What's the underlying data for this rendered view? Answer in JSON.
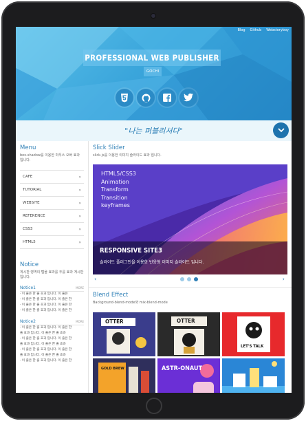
{
  "header": {
    "top_links": [
      "Blog",
      "Github",
      "Webstoryboy"
    ],
    "title": "PROFESSIONAL WEB PUBLISHER",
    "subtitle": "GOCHI",
    "social_icons": [
      "html5-icon",
      "github-icon",
      "facebook-icon",
      "twitter-icon"
    ]
  },
  "slogan": "\"나는 퍼블리셔다\"",
  "sidebar": {
    "menu_title": "Menu",
    "menu_desc": "box-shadow를 이용한 마우스 오버 효과 입니다.",
    "items": [
      {
        "label": "CAFE"
      },
      {
        "label": "TUTORIAL"
      },
      {
        "label": "WEBSITE"
      },
      {
        "label": "REFERENCE"
      },
      {
        "label": "CSS3"
      },
      {
        "label": "HTML5"
      }
    ],
    "notice_title": "Notice",
    "notice_desc": "게시판 영역의 탭을 효과를 두를 효과 게시판 입니다.",
    "notice_groups": [
      {
        "title": "Notice1",
        "more": "MORE",
        "lines": [
          "· 이 줄은 한 줄 효과 입니다. 이 줄은",
          "· 이 줄은 한 줄 효과 입니다. 이 줄은 한",
          "· 이 줄은 한 줄 효과 입니다. 이 줄은 한",
          "· 이 줄은 한 줄 효과 입니다. 이 줄은 한"
        ]
      },
      {
        "title": "Notice2",
        "more": "MORE",
        "lines": [
          "· 이 줄은 한 줄 효과 입니다. 이 줄은 한",
          "줄 효과 입니다. 이 줄은 한 줄 효과",
          "· 이 줄은 한 줄 효과 입니다. 이 줄은 한",
          "줄 효과 입니다. 이 줄은 한 줄 효과",
          "· 이 줄은 한 줄 효과 입니다. 이 줄은 한",
          "줄 효과 입니다. 이 줄은 한 줄 효과",
          "· 이 줄은 한 줄 효과 입니다. 이 줄은 한"
        ]
      }
    ]
  },
  "slick": {
    "title": "Slick Slider",
    "desc": "slick.js를 이용한 이미지 슬라이드 효과 입니다.",
    "slide_words": [
      "HTML5/CSS3",
      "Animation",
      "Transform",
      "Transition",
      "keyframes"
    ],
    "caption_title": "RESPONSIVE SITE3",
    "caption_text": "슬라이드 플러그인을 이용한 반응형 이미지 슬라이드 입니다.",
    "prev": "‹",
    "next": "›",
    "dots": 3,
    "active_dot": 2
  },
  "blend": {
    "title": "Blend Effect",
    "desc": "Background-blend-mode와 mix-blend-mode",
    "tiles": [
      {
        "text": "OTTER",
        "bg": "#3a3d8c"
      },
      {
        "text": "OTTER",
        "bg": "#2a2a2a"
      },
      {
        "text": "LET'S TALK",
        "bg": "#e7292c"
      },
      {
        "text": "GOLD BREW",
        "bg": "#2f2f5c"
      },
      {
        "text": "ASTR-ONAUT",
        "bg": "#6b2fd6"
      },
      {
        "text": "",
        "bg": "#2a86d6"
      }
    ]
  },
  "colors": {
    "accent": "#2d7fb6",
    "header_blue": "#3aa5db",
    "frame": "#1c1c1e"
  }
}
